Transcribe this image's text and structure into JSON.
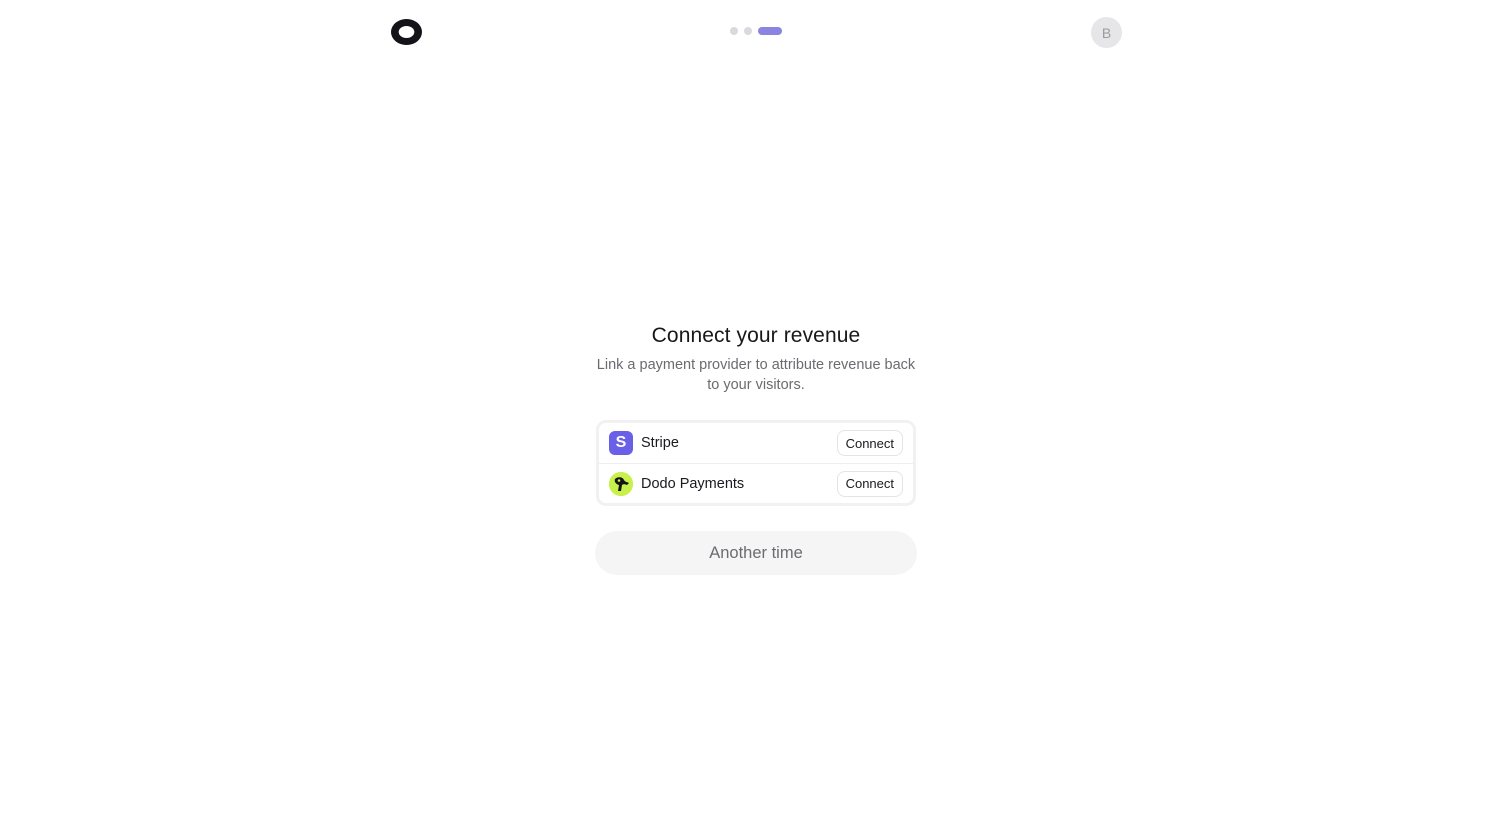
{
  "header": {
    "logo_icon": "ring-logo-icon",
    "progress": {
      "total_steps": 3,
      "current_step": 3
    },
    "avatar_initial": "B"
  },
  "main": {
    "title": "Connect your revenue",
    "subtitle": "Link a payment provider to attribute revenue back to your visitors.",
    "providers": [
      {
        "name": "Stripe",
        "icon": "stripe-icon",
        "icon_letter": "S",
        "icon_color": "#6a60e8",
        "action_label": "Connect"
      },
      {
        "name": "Dodo Payments",
        "icon": "dodo-bird-icon",
        "icon_color": "#c8f04a",
        "action_label": "Connect"
      }
    ],
    "skip_label": "Another time"
  },
  "colors": {
    "accent": "#8b84e0",
    "text": "#18181b",
    "muted": "#6b6b70"
  }
}
